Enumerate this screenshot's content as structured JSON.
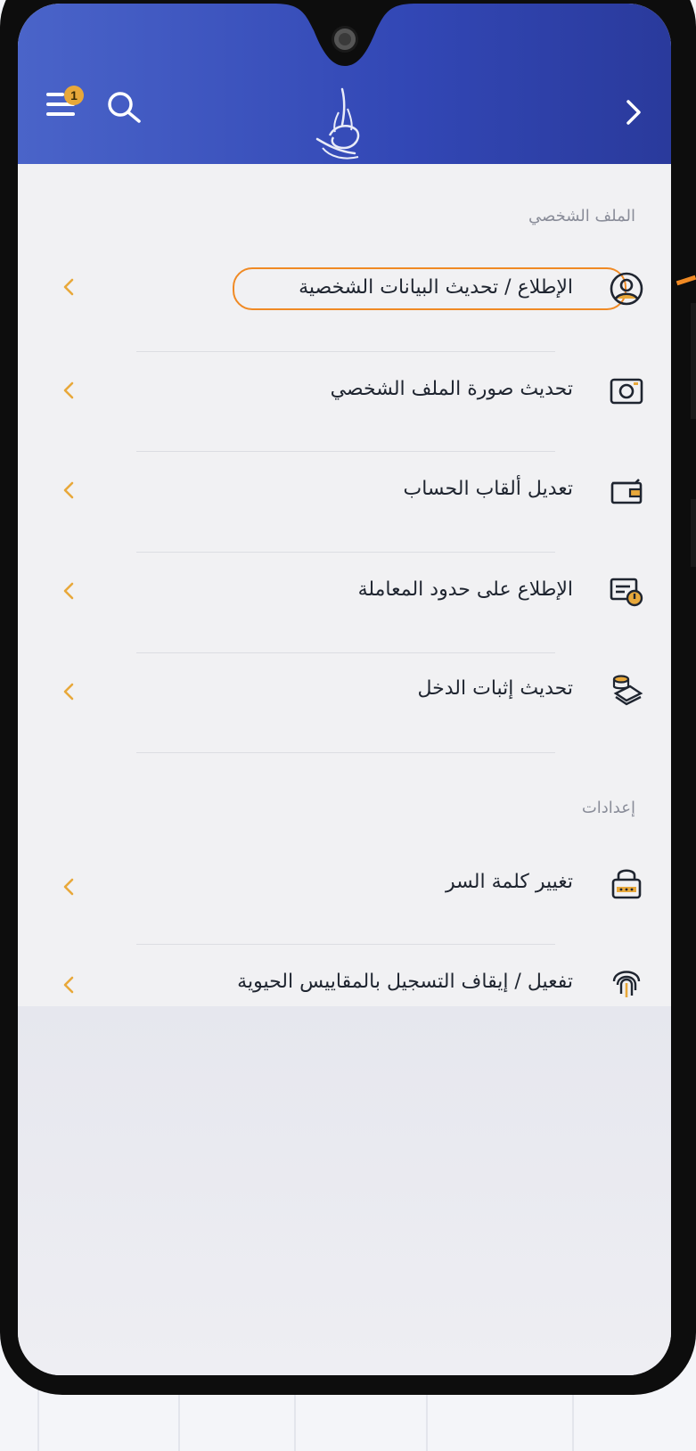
{
  "header": {
    "menu_icon": "hamburger-menu-icon",
    "notification_badge": "1",
    "search_icon": "search-icon",
    "logo_icon": "calligraphy-logo-icon",
    "back_icon": "chevron-right-icon",
    "brand_color": "#3a4fbd",
    "accent_color": "#e8a83a"
  },
  "sections": [
    {
      "title": "الملف الشخصي",
      "items": [
        {
          "label": "الإطلاع / تحديث البيانات الشخصية",
          "icon": "user-profile-icon",
          "highlighted": true
        },
        {
          "label": "تحديث صورة الملف الشخصي",
          "icon": "camera-icon"
        },
        {
          "label": "تعديل ألقاب الحساب",
          "icon": "wallet-icon"
        },
        {
          "label": "الإطلاع على حدود المعاملة",
          "icon": "card-limit-icon"
        },
        {
          "label": "تحديث إثبات الدخل",
          "icon": "money-stack-icon"
        }
      ]
    },
    {
      "title": "إعدادات",
      "items": [
        {
          "label": "تغيير كلمة السر",
          "icon": "password-lock-icon"
        },
        {
          "label": "تفعيل / إيقاف التسجيل بالمقاييس الحيوية",
          "icon": "fingerprint-icon"
        }
      ]
    }
  ],
  "highlight_color": "#f08a24"
}
